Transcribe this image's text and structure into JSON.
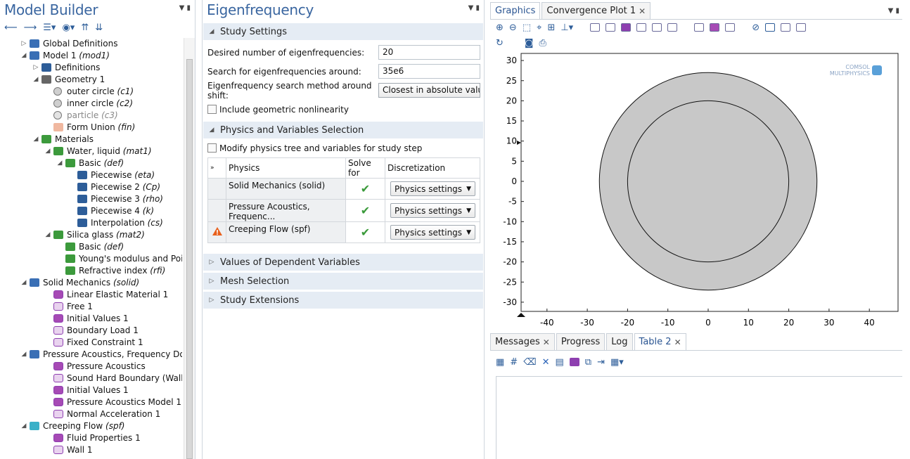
{
  "model_builder": {
    "title": "Model Builder",
    "tree": [
      {
        "depth": 0,
        "arrow": "▷",
        "icon": "globe-icon",
        "label": "Global Definitions",
        "tag": ""
      },
      {
        "depth": 0,
        "arrow": "◢",
        "icon": "model-icon",
        "label": "Model 1 ",
        "tag": "(mod1)"
      },
      {
        "depth": 1,
        "arrow": "▷",
        "icon": "list-icon",
        "label": "Definitions",
        "tag": ""
      },
      {
        "depth": 1,
        "arrow": "◢",
        "icon": "geometry-icon",
        "label": "Geometry 1",
        "tag": ""
      },
      {
        "depth": 2,
        "arrow": "",
        "icon": "circle-icon",
        "label": "outer circle ",
        "tag": "(c1)"
      },
      {
        "depth": 2,
        "arrow": "",
        "icon": "circle-icon",
        "label": "inner circle ",
        "tag": "(c2)"
      },
      {
        "depth": 2,
        "arrow": "",
        "icon": "circle-faded-icon",
        "label": "particle ",
        "tag": "(c3)",
        "faded": true
      },
      {
        "depth": 2,
        "arrow": "",
        "icon": "form-union-icon",
        "label": "Form Union ",
        "tag": "(fin)"
      },
      {
        "depth": 1,
        "arrow": "◢",
        "icon": "materials-icon",
        "label": "Materials",
        "tag": ""
      },
      {
        "depth": 2,
        "arrow": "◢",
        "icon": "material-icon",
        "label": "Water, liquid ",
        "tag": "(mat1)"
      },
      {
        "depth": 3,
        "arrow": "◢",
        "icon": "material-icon",
        "label": "Basic ",
        "tag": "(def)"
      },
      {
        "depth": 4,
        "arrow": "",
        "icon": "function-icon",
        "label": "Piecewise ",
        "tag": "(eta)"
      },
      {
        "depth": 4,
        "arrow": "",
        "icon": "function-icon",
        "label": "Piecewise 2 ",
        "tag": "(Cp)"
      },
      {
        "depth": 4,
        "arrow": "",
        "icon": "function-icon",
        "label": "Piecewise 3 ",
        "tag": "(rho)"
      },
      {
        "depth": 4,
        "arrow": "",
        "icon": "function-icon",
        "label": "Piecewise 4 ",
        "tag": "(k)"
      },
      {
        "depth": 4,
        "arrow": "",
        "icon": "interpolation-icon",
        "label": "Interpolation ",
        "tag": "(cs)"
      },
      {
        "depth": 2,
        "arrow": "◢",
        "icon": "material-icon",
        "label": "Silica glass ",
        "tag": "(mat2)"
      },
      {
        "depth": 3,
        "arrow": "",
        "icon": "material-icon",
        "label": "Basic ",
        "tag": "(def)"
      },
      {
        "depth": 3,
        "arrow": "",
        "icon": "material-icon",
        "label": "Young's modulus and Pois",
        "tag": ""
      },
      {
        "depth": 3,
        "arrow": "",
        "icon": "material-icon",
        "label": "Refractive index ",
        "tag": "(rfi)"
      },
      {
        "depth": 0,
        "arrow": "◢",
        "icon": "solid-mechanics-icon",
        "label": "Solid Mechanics ",
        "tag": "(solid)",
        "indent1": true
      },
      {
        "depth": 2,
        "arrow": "",
        "icon": "domain-node-icon",
        "label": "Linear Elastic Material 1",
        "tag": ""
      },
      {
        "depth": 2,
        "arrow": "",
        "icon": "boundary-node-icon",
        "label": "Free 1",
        "tag": ""
      },
      {
        "depth": 2,
        "arrow": "",
        "icon": "domain-node-icon",
        "label": "Initial Values 1",
        "tag": ""
      },
      {
        "depth": 2,
        "arrow": "",
        "icon": "boundary-node-icon",
        "label": "Boundary Load 1",
        "tag": ""
      },
      {
        "depth": 2,
        "arrow": "",
        "icon": "boundary-node-icon",
        "label": "Fixed Constraint 1",
        "tag": ""
      },
      {
        "depth": 0,
        "arrow": "◢",
        "icon": "acoustics-icon",
        "label": "Pressure Acoustics, Frequency Dor",
        "tag": "",
        "indent1": true
      },
      {
        "depth": 2,
        "arrow": "",
        "icon": "domain-node-icon",
        "label": "Pressure Acoustics",
        "tag": ""
      },
      {
        "depth": 2,
        "arrow": "",
        "icon": "boundary-node-icon",
        "label": "Sound Hard Boundary (Wall) 1",
        "tag": ""
      },
      {
        "depth": 2,
        "arrow": "",
        "icon": "domain-node-icon",
        "label": "Initial Values 1",
        "tag": ""
      },
      {
        "depth": 2,
        "arrow": "",
        "icon": "domain-node-icon",
        "label": "Pressure Acoustics Model 1",
        "tag": ""
      },
      {
        "depth": 2,
        "arrow": "",
        "icon": "boundary-node-icon",
        "label": "Normal Acceleration 1",
        "tag": ""
      },
      {
        "depth": 0,
        "arrow": "◢",
        "icon": "creeping-flow-icon",
        "label": "Creeping Flow ",
        "tag": "(spf)",
        "indent1": true
      },
      {
        "depth": 2,
        "arrow": "",
        "icon": "domain-node-icon",
        "label": "Fluid Properties 1",
        "tag": ""
      },
      {
        "depth": 2,
        "arrow": "",
        "icon": "boundary-node-icon",
        "label": "Wall 1",
        "tag": ""
      }
    ]
  },
  "settings": {
    "title": "Eigenfrequency",
    "study_settings": "Study Settings",
    "num_eig_label": "Desired number of eigenfrequencies:",
    "num_eig": "20",
    "search_label": "Search for eigenfrequencies around:",
    "search": "35e6",
    "method_label": "Eigenfrequency search method around shift:",
    "method": "Closest in absolute valu",
    "geom_nonlin": "Include geometric nonlinearity",
    "phys_sel": "Physics and Variables Selection",
    "modify": "Modify physics tree and variables for study step",
    "col_physics": "Physics",
    "col_solve": "Solve for",
    "col_disc": "Discretization",
    "rows": [
      {
        "name": "Solid Mechanics (solid)",
        "disc": "Physics settings"
      },
      {
        "name": "Pressure Acoustics, Frequenc...",
        "disc": "Physics settings"
      },
      {
        "name": "Creeping Flow (spf)",
        "disc": "Physics settings"
      }
    ],
    "sec_dep": "Values of Dependent Variables",
    "sec_mesh": "Mesh Selection",
    "sec_ext": "Study Extensions"
  },
  "graphics": {
    "tab_graphics": "Graphics",
    "tab_conv": "Convergence Plot 1",
    "logo1": "COMSOL",
    "logo2": "MULTIPHYSICS",
    "y_ticks": [
      "30",
      "25",
      "20",
      "15",
      "10",
      "5",
      "0",
      "-5",
      "-10",
      "-15",
      "-20",
      "-25",
      "-30"
    ],
    "x_ticks": [
      "-40",
      "-30",
      "-20",
      "-10",
      "0",
      "10",
      "20",
      "30",
      "40"
    ],
    "outer_radius": 27,
    "inner_radius": 20
  },
  "messages": {
    "tabs": [
      "Messages",
      "Progress",
      "Log"
    ],
    "table_tab": "Table 2"
  }
}
